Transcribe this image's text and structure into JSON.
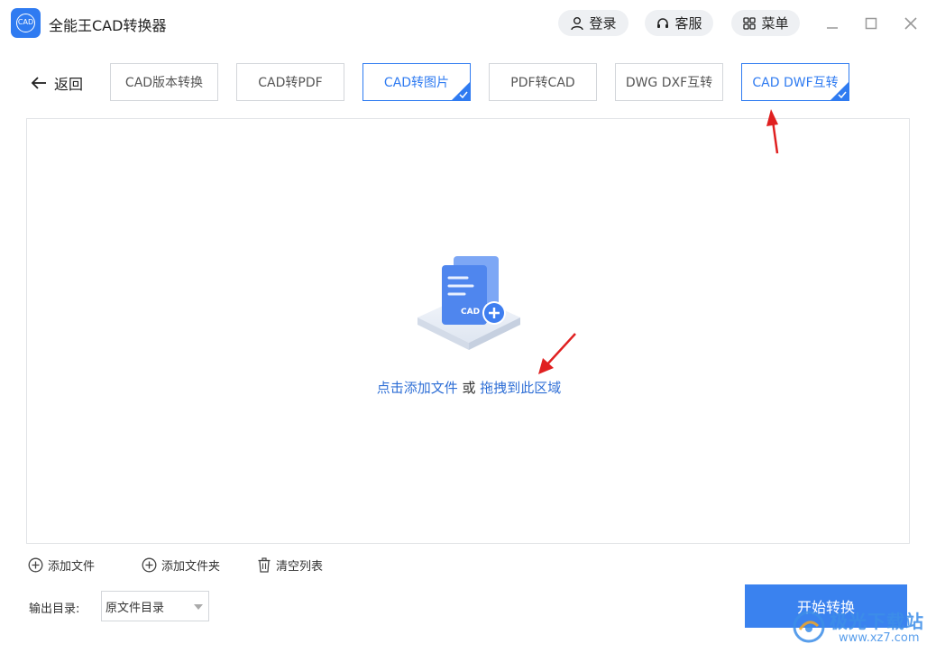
{
  "window": {
    "logo_text": "CAD",
    "title": "全能王CAD转换器",
    "login_label": "登录",
    "service_label": "客服",
    "menu_label": "菜单"
  },
  "nav": {
    "back_label": "返回",
    "tabs": [
      {
        "label": "CAD版本转换",
        "active": false
      },
      {
        "label": "CAD转PDF",
        "active": false
      },
      {
        "label": "CAD转图片",
        "active": true
      },
      {
        "label": "PDF转CAD",
        "active": false
      },
      {
        "label": "DWG DXF互转",
        "active": false
      },
      {
        "label": "CAD DWF互转",
        "active": true
      }
    ]
  },
  "dropzone": {
    "illustration_label": "CAD",
    "hint_click": "点击添加文件",
    "hint_or": " 或 ",
    "hint_drag": "拖拽到此区域"
  },
  "actions": {
    "add_file": "添加文件",
    "add_folder": "添加文件夹",
    "clear_list": "清空列表"
  },
  "output": {
    "label": "输出目录:",
    "selected": "原文件目录"
  },
  "start_button": "开始转换",
  "watermark": {
    "text": "极光下载站",
    "url": "www.xz7.com"
  },
  "colors": {
    "accent": "#2f7bf1",
    "link": "#2f6fd6",
    "start_button": "#3a82ef",
    "annotation_arrow": "#e02020"
  }
}
